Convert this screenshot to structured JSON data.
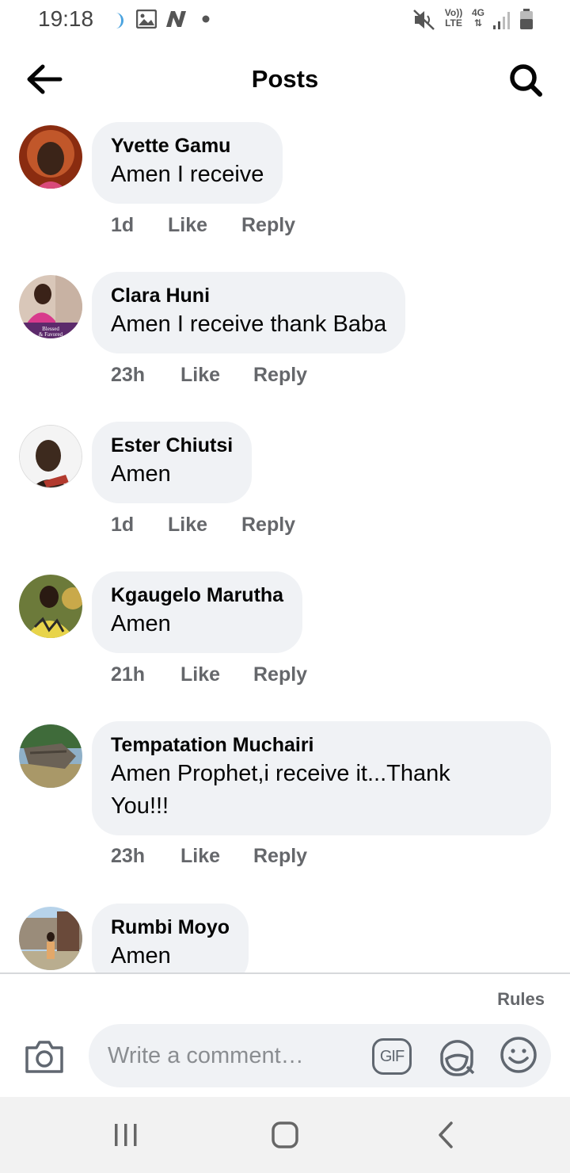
{
  "status_bar": {
    "time": "19:18",
    "icons": [
      "moon-icon",
      "gallery-icon",
      "n-app-icon",
      "dot-icon",
      "mute-icon",
      "volte-icon",
      "4g-icon",
      "signal-icon",
      "battery-icon"
    ],
    "volte_top": "Vo))",
    "volte_bottom": "LTE",
    "network": "4G"
  },
  "header": {
    "title": "Posts",
    "back_icon": "arrow-left-icon",
    "search_icon": "search-icon"
  },
  "comments": [
    {
      "author": "Yvette Gamu",
      "text": "Amen I receive",
      "time": "1d",
      "like": "Like",
      "reply": "Reply"
    },
    {
      "author": "Clara Huni",
      "text": "Amen I receive thank Baba",
      "time": "23h",
      "like": "Like",
      "reply": "Reply",
      "avatar_caption_1": "Blessed",
      "avatar_caption_2": "& Favored"
    },
    {
      "author": "Ester Chiutsi",
      "text": "Amen",
      "time": "1d",
      "like": "Like",
      "reply": "Reply"
    },
    {
      "author": "Kgaugelo Marutha",
      "text": "Amen",
      "time": "21h",
      "like": "Like",
      "reply": "Reply"
    },
    {
      "author": "Tempatation Muchairi",
      "text_line1": "Amen Prophet,i receive it...Thank",
      "text_line2": "You!!!",
      "time": "23h",
      "like": "Like",
      "reply": "Reply"
    },
    {
      "author": "Rumbi Moyo",
      "text": "Amen"
    }
  ],
  "composer": {
    "rules": "Rules",
    "placeholder": "Write a comment…",
    "gif_label": "GIF",
    "icons": [
      "camera-icon",
      "gif-icon",
      "sticker-icon",
      "emoji-icon"
    ]
  },
  "navbar": {
    "icons": [
      "recents-icon",
      "home-icon",
      "back-icon"
    ]
  },
  "colors": {
    "bubble": "#f0f2f5",
    "meta_text": "#65676b",
    "primary_text": "#050505",
    "navbar": "#f2f2f2"
  }
}
